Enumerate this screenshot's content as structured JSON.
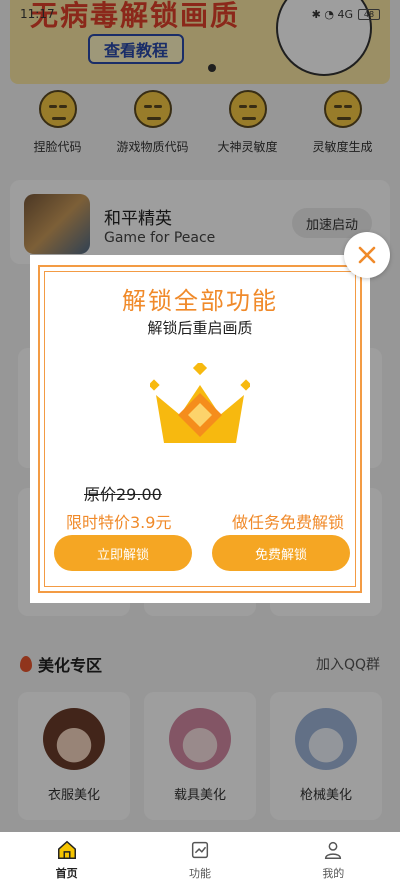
{
  "status": {
    "time": "11:17",
    "icons_text": "✱ ◔ 4G",
    "battery": "48"
  },
  "banner": {
    "title": "无病毒解锁画质",
    "button_label": "查看教程"
  },
  "quick_actions": [
    {
      "label": "捏脸代码",
      "icon": "smirk-face-icon"
    },
    {
      "label": "游戏物质代码",
      "icon": "neutral-face-icon"
    },
    {
      "label": "大神灵敏度",
      "icon": "grin-face-icon"
    },
    {
      "label": "灵敏度生成",
      "icon": "rolling-eyes-face-icon"
    }
  ],
  "game": {
    "name": "和平精英",
    "subtitle": "Game for Peace",
    "accelerate_label": "加速启动"
  },
  "beauty_section": {
    "title": "美化专区",
    "link": "加入QQ群",
    "items": [
      {
        "label": "衣服美化"
      },
      {
        "label": "载具美化"
      },
      {
        "label": "枪械美化"
      }
    ]
  },
  "tabs": [
    {
      "label": "首页",
      "active": true
    },
    {
      "label": "功能",
      "active": false
    },
    {
      "label": "我的",
      "active": false
    }
  ],
  "modal": {
    "title": "解锁全部功能",
    "subtitle": "解锁后重启画质",
    "original_price": "原价29.00",
    "promo_price": "限时特价3.9元",
    "task_text": "做任务免费解锁",
    "buy_button": "立即解锁",
    "free_button": "免费解锁"
  },
  "colors": {
    "accent": "#f08a2a",
    "button": "#f5a623",
    "banner": "#fbe7a4"
  }
}
